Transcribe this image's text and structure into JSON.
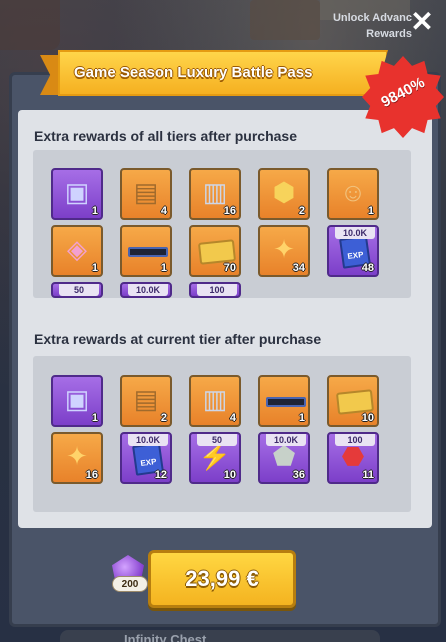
{
  "header": {
    "unlock_line1": "Unlock Advanc",
    "unlock_line2": "Rewards",
    "close_icon": "close-icon"
  },
  "banner": {
    "title": "Game Season Luxury Battle Pass",
    "badge": "9840%"
  },
  "sections": {
    "all_tiers_title": "Extra rewards of all tiers after purchase",
    "current_tier_title": "Extra rewards at current tier after purchase"
  },
  "all_tiers_items": [
    {
      "icon": "purple-cube-chest-icon",
      "color": "purple",
      "count": "1",
      "label": ""
    },
    {
      "icon": "wooden-chest-icon",
      "color": "orange",
      "count": "4",
      "label": ""
    },
    {
      "icon": "silver-chest-icon",
      "color": "orange",
      "count": "16",
      "label": ""
    },
    {
      "icon": "gold-coin-badge-icon",
      "color": "orange",
      "count": "2",
      "label": ""
    },
    {
      "icon": "hero-token-icon",
      "color": "orange",
      "count": "1",
      "label": ""
    },
    {
      "icon": "pink-crate-icon",
      "color": "orange",
      "count": "1",
      "label": ""
    },
    {
      "icon": "dark-bar-icon",
      "color": "orange",
      "count": "1",
      "label": ""
    },
    {
      "icon": "gold-ticket-icon",
      "color": "orange",
      "count": "70",
      "label": ""
    },
    {
      "icon": "puzzle-piece-icon",
      "color": "orange",
      "count": "34",
      "label": ""
    },
    {
      "icon": "exp-book-icon",
      "color": "purple",
      "count": "48",
      "label": "10.0K"
    },
    {
      "icon": "partial-item-icon",
      "color": "purple",
      "count": "",
      "label": "50"
    },
    {
      "icon": "partial-item-icon",
      "color": "purple",
      "count": "",
      "label": "10.0K"
    },
    {
      "icon": "partial-item-icon",
      "color": "purple",
      "count": "",
      "label": "100"
    }
  ],
  "current_tier_items": [
    {
      "icon": "purple-cube-chest-icon",
      "color": "purple",
      "count": "1",
      "label": ""
    },
    {
      "icon": "wooden-chest-icon",
      "color": "orange",
      "count": "2",
      "label": ""
    },
    {
      "icon": "silver-chest-icon",
      "color": "orange",
      "count": "4",
      "label": ""
    },
    {
      "icon": "dark-bar-icon",
      "color": "orange",
      "count": "1",
      "label": ""
    },
    {
      "icon": "gold-ticket-icon",
      "color": "orange",
      "count": "10",
      "label": ""
    },
    {
      "icon": "puzzle-piece-icon",
      "color": "orange",
      "count": "16",
      "label": ""
    },
    {
      "icon": "exp-book-icon",
      "color": "purple",
      "count": "12",
      "label": "10.0K"
    },
    {
      "icon": "lightning-icon",
      "color": "purple",
      "count": "10",
      "label": "50"
    },
    {
      "icon": "grey-stone-icon",
      "color": "purple",
      "count": "36",
      "label": "10.0K"
    },
    {
      "icon": "red-gem-icon",
      "color": "purple",
      "count": "11",
      "label": "100"
    }
  ],
  "purchase": {
    "gem_count": "200",
    "price": "23,99 €"
  },
  "background": {
    "bottom_text": "Infinity Chest"
  },
  "colors": {
    "banner": "#f5b021",
    "badge": "#e8322d",
    "tile_orange": "#e8822a",
    "tile_purple": "#7c3fc9",
    "buy_button": "#f4b320"
  }
}
